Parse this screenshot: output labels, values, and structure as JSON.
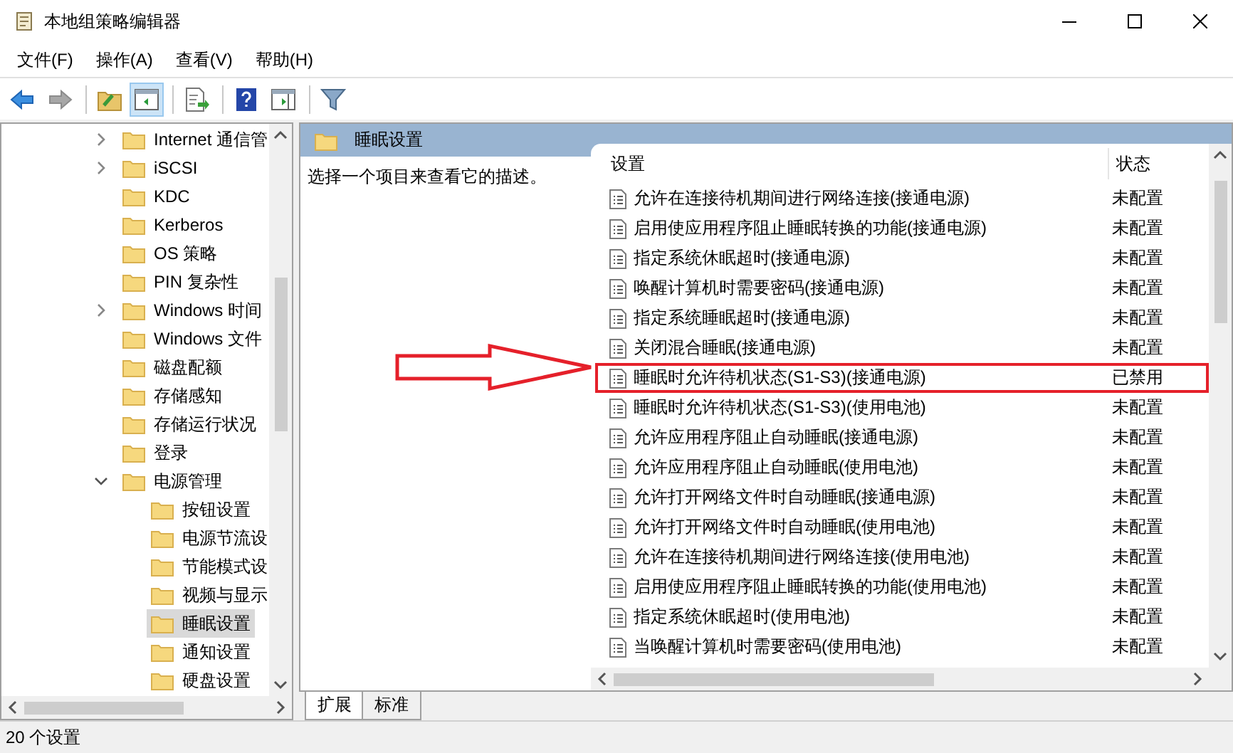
{
  "window": {
    "title": "本地组策略编辑器"
  },
  "menu": [
    "文件(F)",
    "操作(A)",
    "查看(V)",
    "帮助(H)"
  ],
  "toolbar": [
    [
      {
        "kind": "back",
        "pressed": false,
        "disabled": false
      },
      {
        "kind": "forward",
        "pressed": false,
        "disabled": true
      }
    ],
    [
      {
        "kind": "up",
        "pressed": false,
        "disabled": false
      },
      {
        "kind": "tree",
        "pressed": true,
        "disabled": false
      }
    ],
    [
      {
        "kind": "export",
        "pressed": false,
        "disabled": false
      }
    ],
    [
      {
        "kind": "help",
        "pressed": false,
        "disabled": false
      },
      {
        "kind": "actionpane",
        "pressed": false,
        "disabled": false
      }
    ],
    [
      {
        "kind": "filter",
        "pressed": false,
        "disabled": false
      }
    ]
  ],
  "tree": [
    {
      "label": "Internet 通信管",
      "expanded": false,
      "selected": false
    },
    {
      "label": "iSCSI",
      "expanded": false,
      "selected": false
    },
    {
      "label": "KDC",
      "selected": false
    },
    {
      "label": "Kerberos",
      "selected": false
    },
    {
      "label": "OS 策略",
      "selected": false
    },
    {
      "label": "PIN 复杂性",
      "selected": false
    },
    {
      "label": "Windows 时间",
      "expanded": false,
      "selected": false
    },
    {
      "label": "Windows 文件",
      "selected": false
    },
    {
      "label": "磁盘配额",
      "selected": false
    },
    {
      "label": "存储感知",
      "selected": false
    },
    {
      "label": "存储运行状况",
      "selected": false
    },
    {
      "label": "登录",
      "selected": false
    },
    {
      "label": "电源管理",
      "expanded": true,
      "selected": false,
      "children": [
        {
          "label": "按钮设置",
          "selected": false
        },
        {
          "label": "电源节流设",
          "selected": false
        },
        {
          "label": "节能模式设",
          "selected": false
        },
        {
          "label": "视频与显示",
          "selected": false
        },
        {
          "label": "睡眠设置",
          "selected": true
        },
        {
          "label": "通知设置",
          "selected": false
        },
        {
          "label": "硬盘设置",
          "selected": false
        }
      ]
    }
  ],
  "panel": {
    "title": "睡眠设置",
    "description": "选择一个项目来查看它的描述。"
  },
  "table": {
    "columns": [
      "设置",
      "状态"
    ],
    "rows": [
      {
        "name": "允许在连接待机期间进行网络连接(接通电源)",
        "state": "未配置",
        "highlighted": false
      },
      {
        "name": "启用使应用程序阻止睡眠转换的功能(接通电源)",
        "state": "未配置",
        "highlighted": false
      },
      {
        "name": "指定系统休眠超时(接通电源)",
        "state": "未配置",
        "highlighted": false
      },
      {
        "name": "唤醒计算机时需要密码(接通电源)",
        "state": "未配置",
        "highlighted": false
      },
      {
        "name": "指定系统睡眠超时(接通电源)",
        "state": "未配置",
        "highlighted": false
      },
      {
        "name": "关闭混合睡眠(接通电源)",
        "state": "未配置",
        "highlighted": false
      },
      {
        "name": "睡眠时允许待机状态(S1-S3)(接通电源)",
        "state": "已禁用",
        "highlighted": true
      },
      {
        "name": "睡眠时允许待机状态(S1-S3)(使用电池)",
        "state": "未配置",
        "highlighted": false
      },
      {
        "name": "允许应用程序阻止自动睡眠(接通电源)",
        "state": "未配置",
        "highlighted": false
      },
      {
        "name": "允许应用程序阻止自动睡眠(使用电池)",
        "state": "未配置",
        "highlighted": false
      },
      {
        "name": "允许打开网络文件时自动睡眠(接通电源)",
        "state": "未配置",
        "highlighted": false
      },
      {
        "name": "允许打开网络文件时自动睡眠(使用电池)",
        "state": "未配置",
        "highlighted": false
      },
      {
        "name": "允许在连接待机期间进行网络连接(使用电池)",
        "state": "未配置",
        "highlighted": false
      },
      {
        "name": "启用使应用程序阻止睡眠转换的功能(使用电池)",
        "state": "未配置",
        "highlighted": false
      },
      {
        "name": "指定系统休眠超时(使用电池)",
        "state": "未配置",
        "highlighted": false
      },
      {
        "name": "当唤醒计算机时需要密码(使用电池)",
        "state": "未配置",
        "highlighted": false
      }
    ]
  },
  "tabs": [
    {
      "label": "扩展",
      "selected": true
    },
    {
      "label": "标准",
      "selected": false
    }
  ],
  "status_bar": "20 个设置"
}
